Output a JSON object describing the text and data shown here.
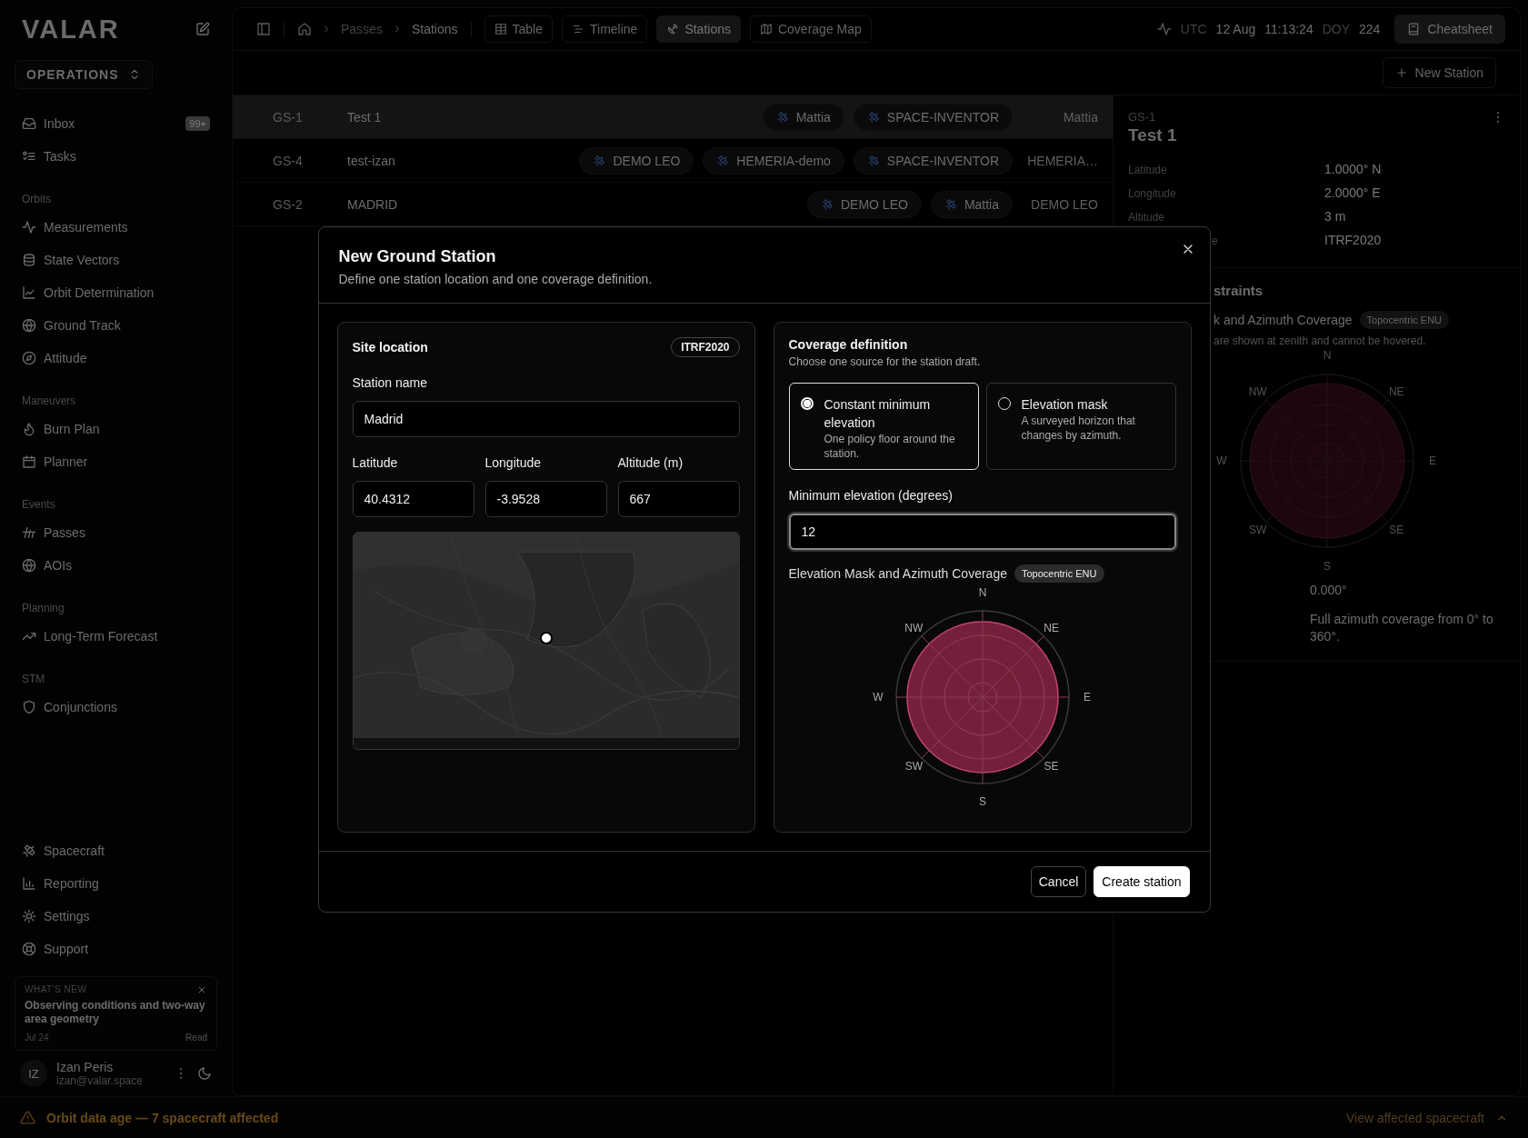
{
  "sidebar": {
    "logo": "VALAR",
    "workspace": "OPERATIONS",
    "items_top": [
      {
        "label": "Inbox",
        "badge": "99+"
      },
      {
        "label": "Tasks"
      }
    ],
    "sections": [
      {
        "title": "Orbits",
        "items": [
          "Measurements",
          "State Vectors",
          "Orbit Determination",
          "Ground Track",
          "Attitude"
        ]
      },
      {
        "title": "Maneuvers",
        "items": [
          "Burn Plan",
          "Planner"
        ]
      },
      {
        "title": "Events",
        "items": [
          "Passes",
          "AOIs"
        ]
      },
      {
        "title": "Planning",
        "items": [
          "Long-Term Forecast"
        ]
      },
      {
        "title": "STM",
        "items": [
          "Conjunctions"
        ]
      }
    ],
    "items_bottom": [
      "Spacecraft",
      "Reporting",
      "Settings",
      "Support"
    ],
    "whats_new": {
      "eyebrow": "WHAT'S NEW",
      "title": "Observing conditions and two-way area geometry",
      "date": "Jul 24",
      "action": "Read"
    },
    "user": {
      "initials": "IZ",
      "name": "Izan Peris",
      "email": "izan@valar.space"
    }
  },
  "topbar": {
    "breadcrumbs": [
      "Passes",
      "Stations"
    ],
    "views": [
      {
        "label": "Table",
        "selected": false
      },
      {
        "label": "Timeline",
        "selected": false
      },
      {
        "label": "Stations",
        "selected": true
      },
      {
        "label": "Coverage Map",
        "selected": false
      }
    ],
    "clock": {
      "zone": "UTC",
      "date": "12 Aug",
      "time": "11:13:24",
      "doy_label": "DOY",
      "doy": "224"
    },
    "cheatsheet": "Cheatsheet"
  },
  "toolbar": {
    "new_station": "New Station"
  },
  "table": {
    "rows": [
      {
        "id": "GS-1",
        "name": "Test 1",
        "chips": [
          "Mattia",
          "SPACE-INVENTOR"
        ],
        "owner": "Mattia",
        "selected": true
      },
      {
        "id": "GS-4",
        "name": "test-izan",
        "chips": [
          "DEMO LEO",
          "HEMERIA-demo",
          "SPACE-INVENTOR"
        ],
        "owner": "HEMERIA…",
        "selected": false
      },
      {
        "id": "GS-2",
        "name": "MADRID",
        "chips": [
          "DEMO LEO",
          "Mattia"
        ],
        "owner": "DEMO LEO",
        "selected": false
      }
    ]
  },
  "detail": {
    "code": "GS-1",
    "title": "Test 1",
    "fields": [
      {
        "label": "Latitude",
        "value": "1.0000° N"
      },
      {
        "label": "Longitude",
        "value": "2.0000° E"
      },
      {
        "label": "Altitude",
        "value": "3 m"
      },
      {
        "label": "e",
        "value": "ITRF2020"
      }
    ],
    "constraints": {
      "heading": "straints",
      "chart_title": "k and Azimuth Coverage",
      "badge": "Topocentric ENU",
      "note": "are shown at zenith and cannot be hovered.",
      "directions": [
        "N",
        "NE",
        "E",
        "SE",
        "S",
        "SW",
        "W",
        "NW"
      ],
      "min_elevation": "0.000°",
      "coverage": "Full azimuth coverage from 0° to 360°."
    }
  },
  "modal": {
    "title": "New Ground Station",
    "subtitle": "Define one station location and one coverage definition.",
    "site": {
      "heading": "Site location",
      "frame": "ITRF2020",
      "name_label": "Station name",
      "name_value": "Madrid",
      "coords": [
        {
          "label": "Latitude",
          "value": "40.4312"
        },
        {
          "label": "Longitude",
          "value": "-3.9528"
        },
        {
          "label": "Altitude (m)",
          "value": "667"
        }
      ]
    },
    "coverage": {
      "heading": "Coverage definition",
      "subtitle": "Choose one source for the station draft.",
      "options": [
        {
          "title": "Constant minimum elevation",
          "description": "One policy floor around the station.",
          "selected": true
        },
        {
          "title": "Elevation mask",
          "description": "A surveyed horizon that changes by azimuth.",
          "selected": false
        }
      ],
      "min_label": "Minimum elevation (degrees)",
      "min_value": "12",
      "chart_title": "Elevation Mask and Azimuth Coverage",
      "badge": "Topocentric ENU",
      "directions": [
        "N",
        "NE",
        "E",
        "SE",
        "S",
        "SW",
        "W",
        "NW"
      ]
    },
    "buttons": [
      {
        "label": "Cancel",
        "kind": "secondary"
      },
      {
        "label": "Create station",
        "kind": "primary"
      }
    ]
  },
  "status_bar": {
    "message": "Orbit data age — 7 spacecraft affected",
    "action": "View affected spacecraft"
  }
}
